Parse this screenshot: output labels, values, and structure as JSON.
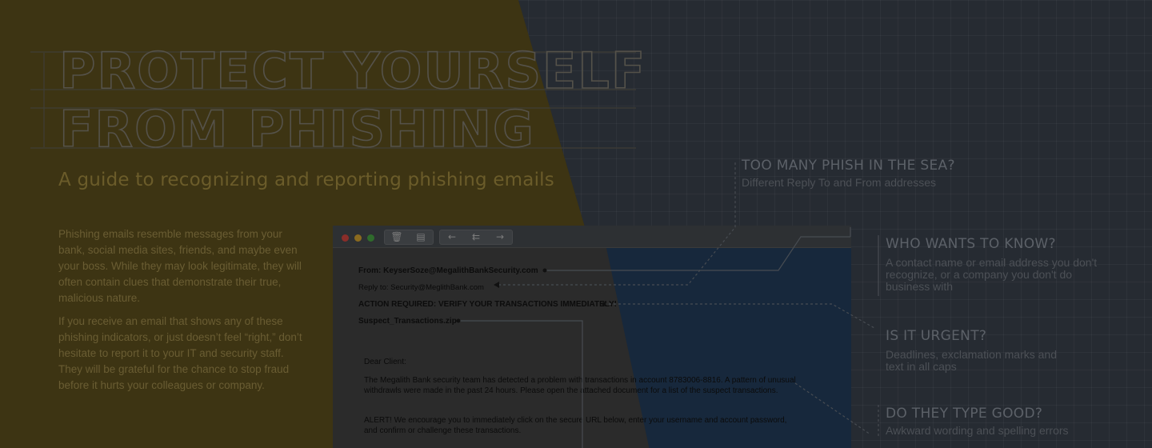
{
  "title": {
    "line1": "PROTECT YOURSELF",
    "line2": "FROM PHISHING"
  },
  "subtitle": "A guide to recognizing and reporting phishing emails",
  "paragraphs": [
    "Phishing emails resemble messages from your bank, social media sites, friends, and maybe even your boss. While they may look legitimate, they will often contain clues that demonstrate their true, malicious nature.",
    "If you receive an email that shows any of these phishing indicators, or just doesn’t feel “right,” don’t hesitate to report it to your IT and security staff. They will be grateful for the chance to stop fraud before it hurts your colleagues or company."
  ],
  "email": {
    "from": "From: KeyserSoze@MegalithBankSecurity.com",
    "reply_to": "Reply to: Security@MeglithBank.com",
    "subject": "ACTION REQUIRED: VERIFY YOUR TRANSACTIONS IMMEDIATELY!",
    "attachment": "Suspect_Transactions.zip",
    "greeting": "Dear Client:",
    "body1": "The Megalith Bank security team has detected a problem with transactions in account 8783006-8816. A pattern of unusual withdrawls were made in the past 24 hours. Please open the attached document for a list of the suspect transactions.",
    "body2": "ALERT! We encourage you to immediately click on the secure URL below, enter your username and account password, and confirm or challenge these transactions."
  },
  "toolbar_icons": [
    "trash-icon",
    "archive-icon",
    "reply-icon",
    "reply-all-icon",
    "forward-icon"
  ],
  "window_dot_colors": [
    "#8a2d29",
    "#8a6a1f",
    "#2f6b2c"
  ],
  "callouts": [
    {
      "heading": "TOO MANY PHISH IN THE SEA?",
      "desc": "Different Reply To and From addresses"
    },
    {
      "heading": "WHO WANTS TO KNOW?",
      "desc": "A contact name or email address you don't recognize, or a company you don't do business with"
    },
    {
      "heading": "IS IT URGENT?",
      "desc": "Deadlines, exclamation marks and text in all caps"
    },
    {
      "heading": "DO THEY TYPE GOOD?",
      "desc": "Awkward wording and spelling errors"
    }
  ],
  "colors": {
    "left_panel": "#3d3413",
    "right_panel": "#262b32",
    "email_dark": "#17283c"
  }
}
